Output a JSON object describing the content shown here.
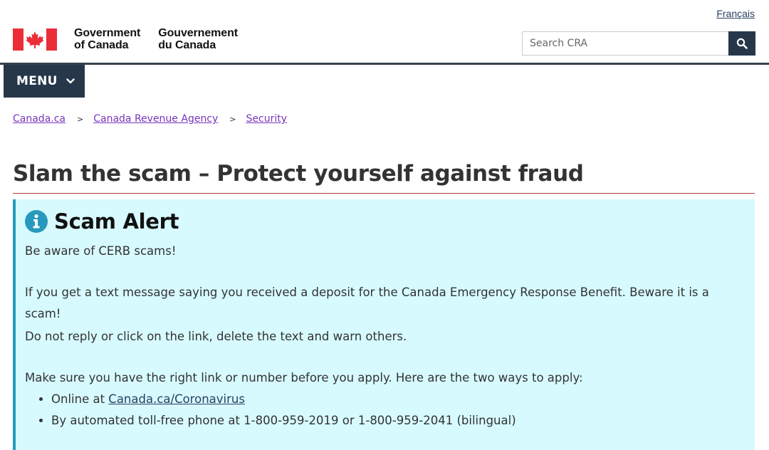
{
  "header": {
    "language_link": "Français",
    "wordmark": {
      "en_line1": "Government",
      "en_line2": "of Canada",
      "fr_line1": "Gouvernement",
      "fr_line2": "du Canada"
    },
    "search": {
      "placeholder": "Search CRA",
      "icon": "search-icon"
    },
    "menu_label": "MENU"
  },
  "breadcrumb": [
    "Canada.ca",
    "Canada Revenue Agency",
    "Security"
  ],
  "breadcrumb_separator": ">",
  "page_title": "Slam the scam – Protect yourself against fraud",
  "alert": {
    "icon": "info-icon",
    "title": "Scam Alert",
    "p1": "Be aware of CERB scams!",
    "p2": "If you get a text message saying you received a deposit for the Canada Emergency Response Benefit. Beware it is a scam!",
    "p3": "Do not reply or click on the link, delete the text and warn others.",
    "p4": "Make sure you have the right link or number before you apply. Here are the two ways to apply:",
    "list": {
      "item1_prefix": "Online at ",
      "item1_link": "Canada.ca/Coronavirus",
      "item2": "By automated toll-free phone at 1-800-959-2019 or 1-800-959-2041 (bilingual)"
    }
  },
  "colors": {
    "navy": "#26374a",
    "alert_bg": "#d7faff",
    "alert_border": "#269abc",
    "title_rule": "#af3c43",
    "visited_link": "#7834bc",
    "flag_red": "#eb2d37"
  }
}
